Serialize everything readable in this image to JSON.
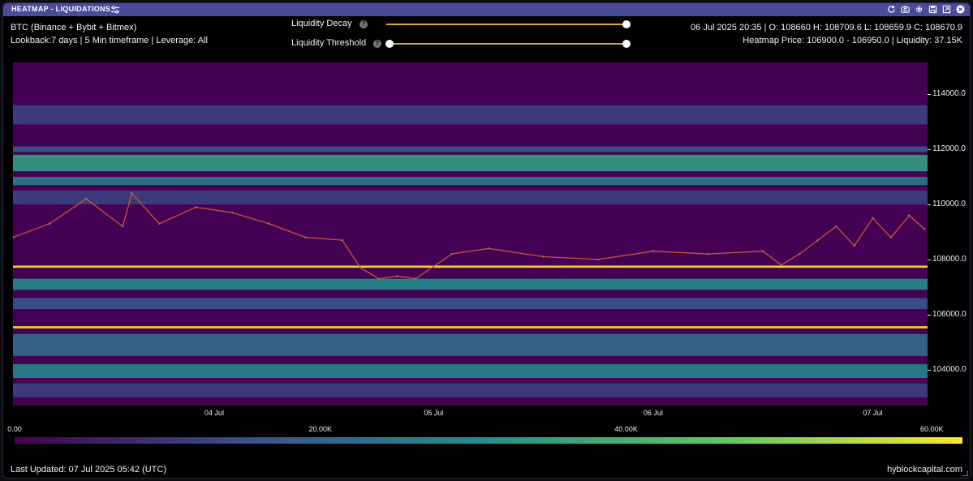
{
  "window": {
    "title": "HEATMAP - LIQUIDATIONS",
    "buttons": [
      "refresh-icon",
      "camera-icon",
      "gear-icon",
      "save-icon",
      "expand-icon",
      "close-icon"
    ]
  },
  "header": {
    "market": "BTC (Binance + Bybit + Bitmex)",
    "settings": "Lookback:7 days | 5 Min timeframe | Leverage: All",
    "ohlc": "06 Jul 2025 20:35 | O: 108660 H: 108709.6 L: 108659.9 C: 108670.9",
    "heatmap_info": "Heatmap Price: 106900.0 - 106950.0 | Liquidity: 37.15K"
  },
  "controls": {
    "decay_label": "Liquidity Decay",
    "threshold_label": "Liquidity Threshold",
    "help_glyph": "?",
    "decay_value": 1.0,
    "threshold_range": [
      0.0,
      1.0
    ]
  },
  "footer": {
    "last_updated": "Last Updated: 07 Jul 2025 05:42 (UTC)",
    "brand": "hyblockcapital.com"
  },
  "colors": {
    "titlebar": "#4a4a9e",
    "accent": "#e3a440",
    "background": "#000000",
    "scale": [
      "#440154",
      "#3b528b",
      "#21918c",
      "#5ec962",
      "#fde725"
    ]
  },
  "chart_data": {
    "type": "heatmap",
    "title": "",
    "xlabel": "",
    "ylabel": "",
    "x_ticks": [
      "04 Jul",
      "05 Jul",
      "06 Jul",
      "07 Jul"
    ],
    "y_ticks": [
      "114000.0",
      "112000.0",
      "110000.0",
      "108000.0",
      "106000.0",
      "104000.0"
    ],
    "y_tick_values": [
      114000,
      112000,
      110000,
      108000,
      106000,
      104000
    ],
    "ylim": [
      102700,
      115150
    ],
    "xlim": [
      "2025-07-03T02:00",
      "2025-07-07T06:00"
    ],
    "x_tick_dates": [
      "2025-07-04T00:00",
      "2025-07-05T00:00",
      "2025-07-06T00:00",
      "2025-07-07T00:00"
    ],
    "colorscale_ticks": [
      "0.00",
      "20.00K",
      "40.00K",
      "60.00K"
    ],
    "colorscale_range": [
      0,
      62000
    ],
    "liquidity_bands": [
      {
        "price_low": 112900,
        "price_high": 113600,
        "value": 12000
      },
      {
        "price_low": 111900,
        "price_high": 112100,
        "value": 18000
      },
      {
        "price_low": 111200,
        "price_high": 111800,
        "value": 35000
      },
      {
        "price_low": 110700,
        "price_high": 111000,
        "value": 25000
      },
      {
        "price_low": 110000,
        "price_high": 110500,
        "value": 12000
      },
      {
        "price_low": 107700,
        "price_high": 107780,
        "value": 62000
      },
      {
        "price_low": 106900,
        "price_high": 107300,
        "value": 30000
      },
      {
        "price_low": 106200,
        "price_high": 106600,
        "value": 16000
      },
      {
        "price_low": 105500,
        "price_high": 105580,
        "value": 62000
      },
      {
        "price_low": 104500,
        "price_high": 105300,
        "value": 22000
      },
      {
        "price_low": 103700,
        "price_high": 104200,
        "value": 28000
      },
      {
        "price_low": 103000,
        "price_high": 103500,
        "value": 12000
      }
    ],
    "price_series": {
      "name": "",
      "x": [
        "2025-07-03T02:00",
        "2025-07-03T06:00",
        "2025-07-03T10:00",
        "2025-07-03T14:00",
        "2025-07-03T15:00",
        "2025-07-03T18:00",
        "2025-07-03T22:00",
        "2025-07-04T02:00",
        "2025-07-04T06:00",
        "2025-07-04T10:00",
        "2025-07-04T14:00",
        "2025-07-04T16:00",
        "2025-07-04T18:00",
        "2025-07-04T20:00",
        "2025-07-04T22:00",
        "2025-07-05T02:00",
        "2025-07-05T06:00",
        "2025-07-05T12:00",
        "2025-07-05T18:00",
        "2025-07-06T00:00",
        "2025-07-06T06:00",
        "2025-07-06T12:00",
        "2025-07-06T14:00",
        "2025-07-06T16:00",
        "2025-07-06T18:00",
        "2025-07-06T20:00",
        "2025-07-06T22:00",
        "2025-07-07T00:00",
        "2025-07-07T02:00",
        "2025-07-07T04:00",
        "2025-07-07T05:40"
      ],
      "y": [
        108800,
        109300,
        110200,
        109200,
        110400,
        109300,
        109900,
        109700,
        109300,
        108800,
        108700,
        107700,
        107300,
        107400,
        107300,
        108200,
        108400,
        108100,
        108000,
        108300,
        108200,
        108300,
        107800,
        108200,
        108700,
        109200,
        108500,
        109500,
        108800,
        109600,
        109100
      ]
    }
  }
}
